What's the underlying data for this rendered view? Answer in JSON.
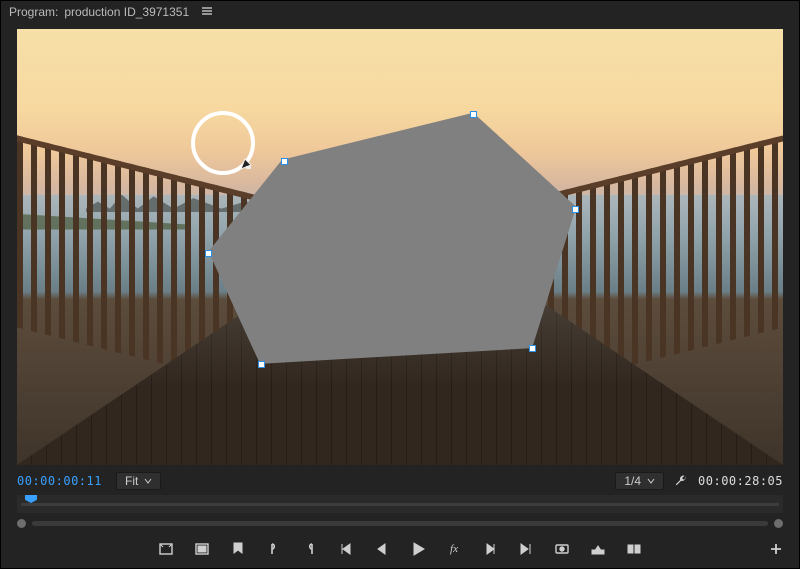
{
  "panel": {
    "title_prefix": "Program:",
    "sequence_name": "production ID_3971351"
  },
  "playback": {
    "current_timecode": "00:00:00:11",
    "duration_timecode": "00:00:28:05",
    "zoom_label": "Fit",
    "resolution_label": "1/4"
  },
  "shape": {
    "type": "pen-mask",
    "fill_color": "#808080",
    "stroke_color": "#4aa3ff",
    "anchor_count": 6
  },
  "transport_icons": [
    "safe-margins-icon",
    "toggle-multicam-icon",
    "marker-icon",
    "mark-in-icon",
    "mark-out-icon",
    "go-to-in-icon",
    "step-back-icon",
    "play-icon",
    "fx-icon",
    "step-forward-icon",
    "go-to-out-icon",
    "export-frame-icon",
    "lift-icon",
    "extract-icon"
  ],
  "colors": {
    "panel_bg": "#232323",
    "accent_blue": "#3aa0ff",
    "text": "#cccccc"
  }
}
